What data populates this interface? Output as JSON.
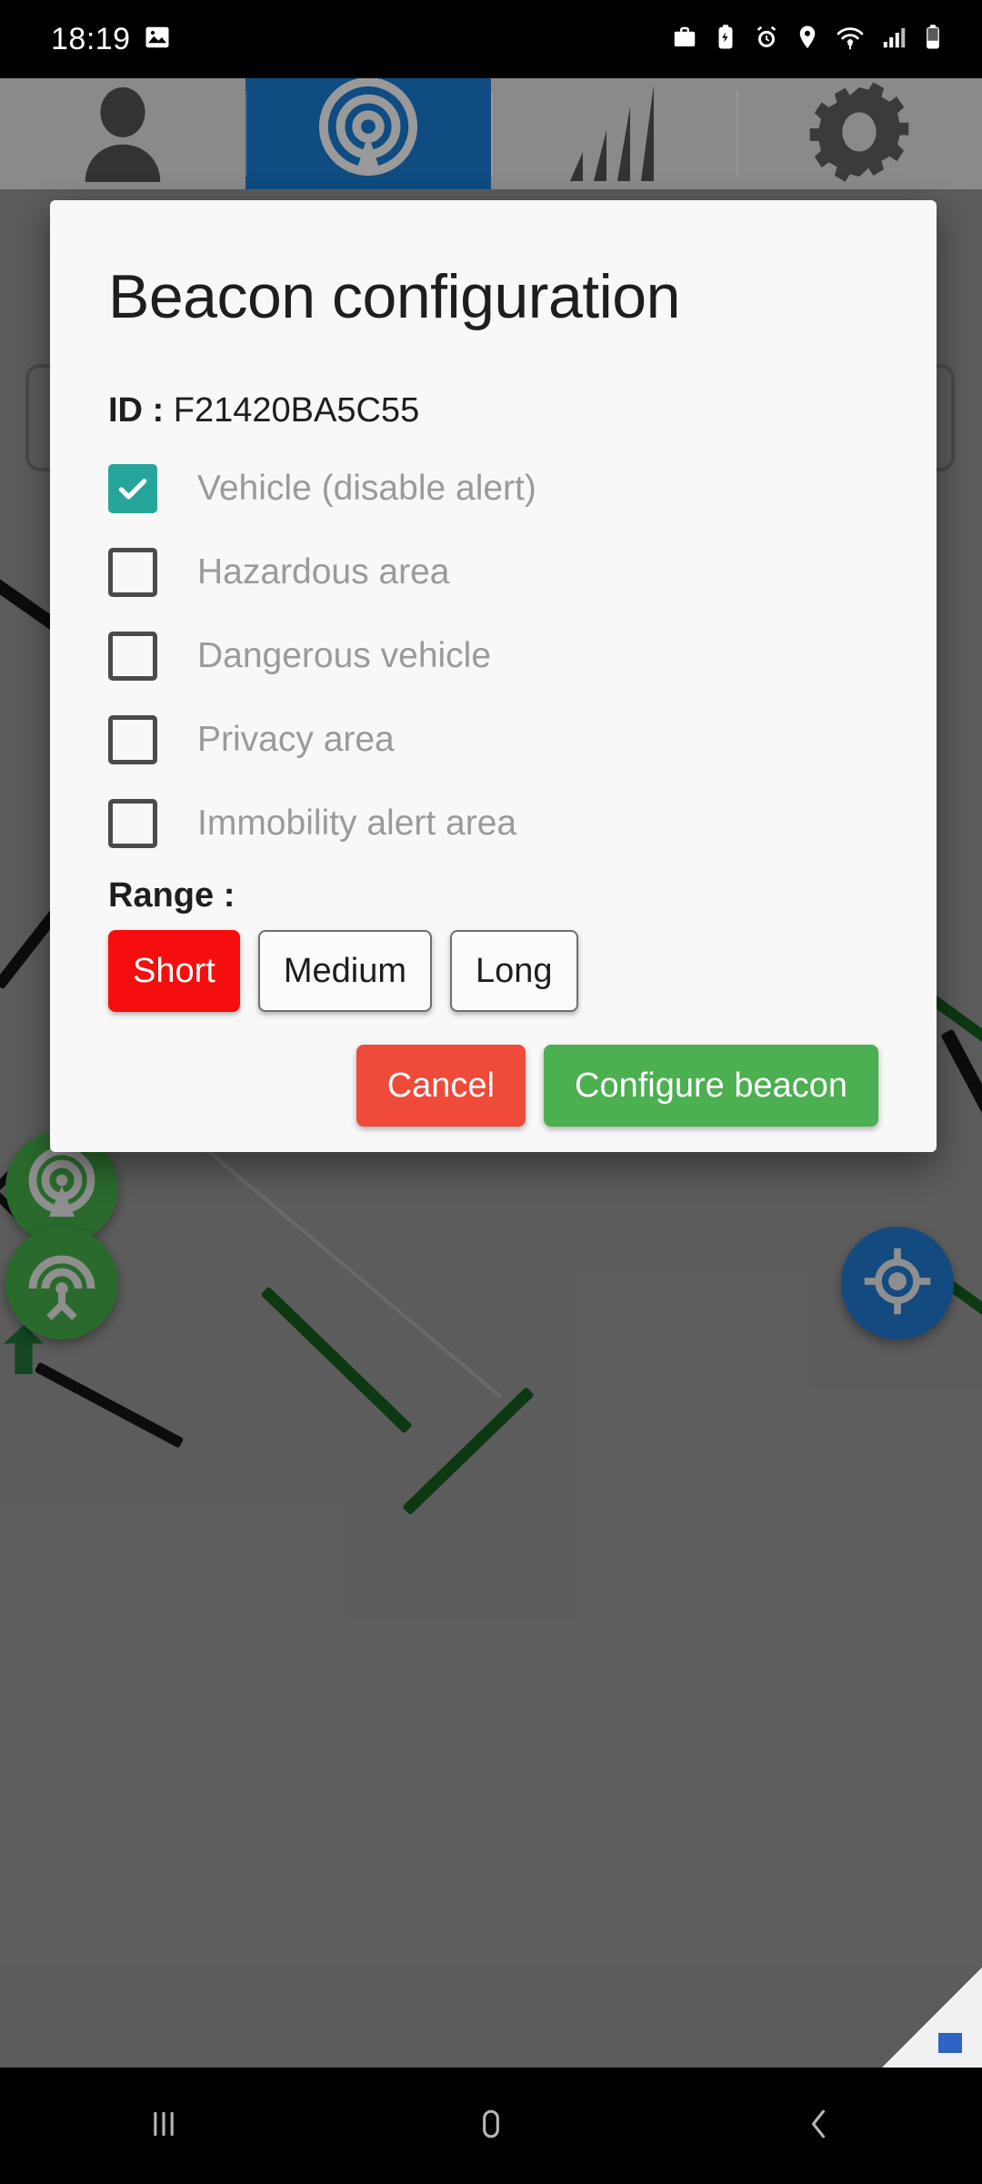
{
  "status_bar": {
    "time": "18:19",
    "left_icons": [
      "image-icon"
    ],
    "right_icons": [
      "briefcase-icon",
      "battery-saver-icon",
      "alarm-icon",
      "location-icon",
      "wifi-icon",
      "signal-icon",
      "battery-icon"
    ]
  },
  "top_tabs": [
    {
      "name": "person-tab",
      "icon": "person-icon",
      "selected": false
    },
    {
      "name": "beacon-tab",
      "icon": "beacon-icon",
      "selected": true
    },
    {
      "name": "signal-tab",
      "icon": "signal-bars-icon",
      "selected": false
    },
    {
      "name": "settings-tab",
      "icon": "gear-icon",
      "selected": false
    }
  ],
  "dialog": {
    "title": "Beacon configuration",
    "id_label": "ID :",
    "id_value": "F21420BA5C55",
    "checkboxes": [
      {
        "label": "Vehicle (disable alert)",
        "checked": true
      },
      {
        "label": "Hazardous area",
        "checked": false
      },
      {
        "label": "Dangerous vehicle",
        "checked": false
      },
      {
        "label": "Privacy area",
        "checked": false
      },
      {
        "label": "Immobility alert area",
        "checked": false
      }
    ],
    "range_label": "Range :",
    "range_options": [
      {
        "label": "Short",
        "selected": true
      },
      {
        "label": "Medium",
        "selected": false
      },
      {
        "label": "Long",
        "selected": false
      }
    ],
    "cancel_label": "Cancel",
    "confirm_label": "Configure beacon"
  },
  "map": {
    "fabs": [
      {
        "name": "beacon-scan-fab",
        "icon": "beacon-icon",
        "color": "#2a6b2d"
      },
      {
        "name": "broadcast-fab",
        "icon": "antenna-icon",
        "color": "#2a6b2d"
      },
      {
        "name": "my-location-fab",
        "icon": "crosshair-icon",
        "color": "#134a80"
      }
    ]
  },
  "nav_bar": {
    "buttons": [
      {
        "name": "recents-button",
        "icon": "recents-icon"
      },
      {
        "name": "home-button",
        "icon": "home-icon"
      },
      {
        "name": "back-button",
        "icon": "back-icon"
      }
    ]
  },
  "colors": {
    "accent_blue": "#0f4c81",
    "checkbox_teal": "#26a69a",
    "range_selected_red": "#f60d0d",
    "cancel_red": "#ef4a3a",
    "confirm_green": "#4caf50",
    "dialog_bg": "#f8f8f8"
  }
}
